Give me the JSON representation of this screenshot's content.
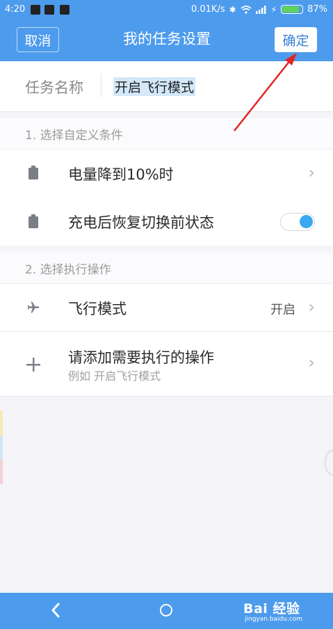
{
  "status_bar": {
    "time": "4:20",
    "network_speed": "0.01K/s",
    "battery_percent": "87%",
    "battery_level": 0.87
  },
  "header": {
    "title": "我的任务设置",
    "cancel_label": "取消",
    "confirm_label": "确定"
  },
  "task_name": {
    "label": "任务名称",
    "value": "开启飞行模式"
  },
  "section_conditions": {
    "title": "1. 选择自定义条件",
    "items": [
      {
        "label": "电量降到10%时",
        "icon": "battery-icon"
      },
      {
        "label": "充电后恢复切换前状态",
        "icon": "battery-icon",
        "toggle_on": true
      }
    ]
  },
  "section_actions": {
    "title": "2. 选择执行操作",
    "items": [
      {
        "label": "飞行模式",
        "value": "开启",
        "icon": "airplane-icon"
      },
      {
        "label": "请添加需要执行的操作",
        "sub": "例如 开启飞行模式",
        "icon": "plus-icon"
      }
    ]
  },
  "watermark": {
    "logo": "Bai 经验",
    "url": "jingyan.baidu.com"
  },
  "colors": {
    "accent": "#4d9bec",
    "toggle_on": "#3aa8f3",
    "annotation_arrow": "#e02424"
  }
}
